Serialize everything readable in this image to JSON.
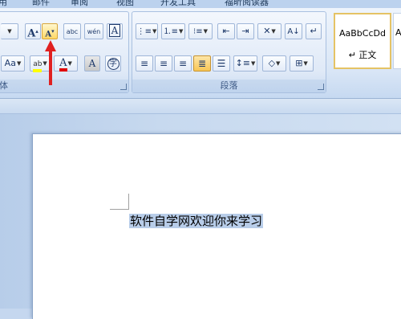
{
  "tabs": [
    {
      "label": "用"
    },
    {
      "label": "邮件"
    },
    {
      "label": "审阅"
    },
    {
      "label": "视图"
    },
    {
      "label": "开发工具"
    },
    {
      "label": "福昕阅读器"
    }
  ],
  "font_group": {
    "label": "体",
    "buttons": {
      "grow_font": "A",
      "shrink_font": "A",
      "phonetic_guide": "abc",
      "clear_format": "wén",
      "char_border": "A",
      "change_case": "Aa",
      "highlight": "ab",
      "font_color": "A",
      "char_shading": "A",
      "enclose_char": "字"
    }
  },
  "paragraph_group": {
    "label": "段落"
  },
  "styles_group": {
    "style1_sample": "AaBbCcDd",
    "style1_name": "↵ 正文",
    "style2_sample": "A"
  },
  "document": {
    "text": "软件自学网欢迎你来学习"
  },
  "colors": {
    "accent_highlight": "#ffd866",
    "annotation_arrow": "#e02020",
    "selection": "#b8cde9",
    "font_color_bar": "#e00000",
    "highlight_bar": "#ffff00"
  }
}
